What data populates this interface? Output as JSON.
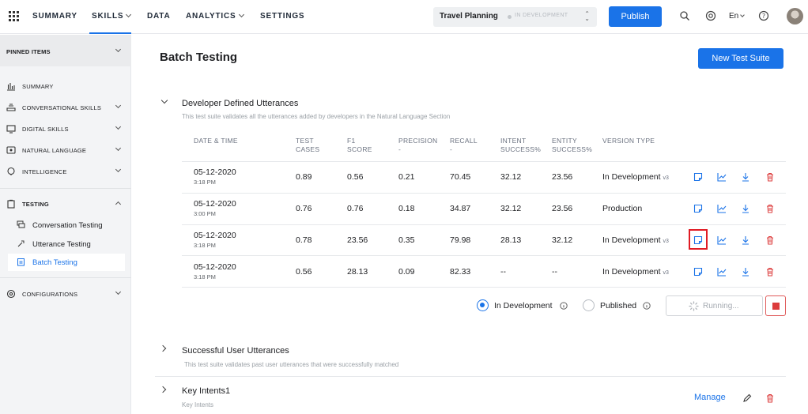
{
  "nav": {
    "items": [
      {
        "label": "SUMMARY",
        "dropdown": false
      },
      {
        "label": "SKILLS",
        "dropdown": true
      },
      {
        "label": "DATA",
        "dropdown": false
      },
      {
        "label": "ANALYTICS",
        "dropdown": true
      },
      {
        "label": "SETTINGS",
        "dropdown": false
      }
    ],
    "active": "SKILLS",
    "project_name": "Travel Planning",
    "project_status": "IN DEVELOPMENT",
    "publish_label": "Publish",
    "language": "En",
    "icons": [
      "apps-grid-icon",
      "search-icon",
      "settings-icon",
      "help-icon",
      "avatar"
    ]
  },
  "sidebar": {
    "pinned_label": "PINNED ITEMS",
    "items": [
      {
        "label": "SUMMARY",
        "icon": "bar-chart-icon",
        "chevron": false
      },
      {
        "label": "CONVERSATIONAL SKILLS",
        "icon": "layers-icon",
        "chevron": true
      },
      {
        "label": "DIGITAL SKILLS",
        "icon": "monitor-icon",
        "chevron": true
      },
      {
        "label": "NATURAL LANGUAGE",
        "icon": "nlp-icon",
        "chevron": true
      },
      {
        "label": "INTELLIGENCE",
        "icon": "brain-icon",
        "chevron": true
      }
    ],
    "testing_label": "TESTING",
    "testing_sub": [
      {
        "label": "Conversation Testing",
        "icon": "chat-icon"
      },
      {
        "label": "Utterance Testing",
        "icon": "utterance-icon"
      },
      {
        "label": "Batch Testing",
        "icon": "clipboard-icon"
      }
    ],
    "configurations_label": "CONFIGURATIONS"
  },
  "main": {
    "title": "Batch Testing",
    "new_suite_label": "New Test Suite",
    "suite1": {
      "title": "Developer Defined Utterances",
      "description": "This test suite validates all the utterances added by developers in the Natural Language Section"
    },
    "table": {
      "headers": [
        [
          "DATE & TIME",
          ""
        ],
        [
          "TEST",
          "CASES"
        ],
        [
          "F1",
          "SCORE"
        ],
        [
          "PRECISION",
          "-"
        ],
        [
          "RECALL",
          "-"
        ],
        [
          "INTENT",
          "SUCCESS%"
        ],
        [
          "ENTITY",
          "SUCCESS%"
        ],
        [
          "VERSION TYPE",
          ""
        ]
      ],
      "rows": [
        {
          "date": "05-12-2020",
          "time": "3:18 PM",
          "test_cases": "0.89",
          "f1": "0.56",
          "precision": "0.21",
          "recall": "70.45",
          "intent": "32.12",
          "entity": "23.56",
          "version": "In Development",
          "version_tag": "v3"
        },
        {
          "date": "05-12-2020",
          "time": "3:00 PM",
          "test_cases": "0.76",
          "f1": "0.76",
          "precision": "0.18",
          "recall": "34.87",
          "intent": "32.12",
          "entity": "23.56",
          "version": "Production",
          "version_tag": ""
        },
        {
          "date": "05-12-2020",
          "time": "3:18 PM",
          "test_cases": "0.78",
          "f1": "23.56",
          "precision": "0.35",
          "recall": "79.98",
          "intent": "28.13",
          "entity": "32.12",
          "version": "In Development",
          "version_tag": "v3"
        },
        {
          "date": "05-12-2020",
          "time": "3:18 PM",
          "test_cases": "0.56",
          "f1": "28.13",
          "precision": "0.09",
          "recall": "82.33",
          "intent": "--",
          "entity": "--",
          "version": "In Development",
          "version_tag": "v3"
        }
      ],
      "row_actions": [
        "note-icon",
        "trend-chart-icon",
        "download-icon",
        "delete-icon"
      ]
    },
    "run": {
      "option_dev": "In Development",
      "option_pub": "Published",
      "selected": "In Development",
      "running_label": "Running..."
    },
    "suite2": {
      "title": "Successful User Utterances",
      "description": "This test suite validates past user utterances that were successfully matched"
    },
    "suite3": {
      "title": "Key Intents1",
      "description": "Key Intents",
      "manage_label": "Manage"
    },
    "colors": {
      "accent": "#1a73e8",
      "danger": "#dc3c3c",
      "highlight": "#e01b24"
    }
  }
}
